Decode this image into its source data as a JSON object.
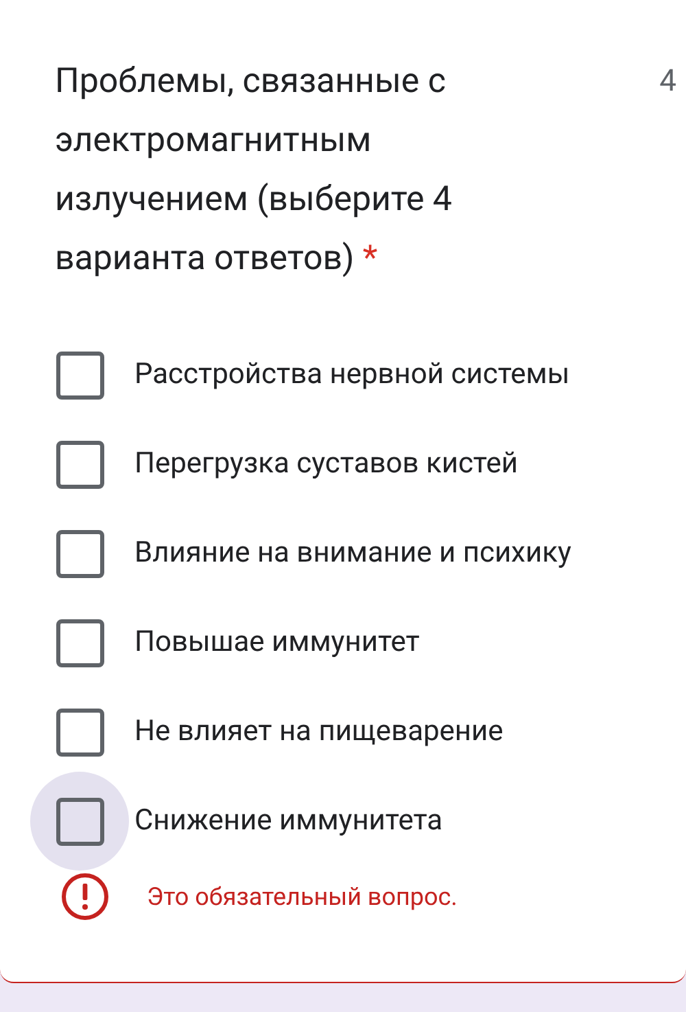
{
  "question": {
    "title": "Проблемы, связанные с электромагнитным излучением (выберите 4 варианта ответов)",
    "required_mark": "*",
    "points": "4"
  },
  "options": [
    {
      "label": "Расстройства нервной системы",
      "checked": false,
      "focused": false
    },
    {
      "label": "Перегрузка суставов кистей",
      "checked": false,
      "focused": false
    },
    {
      "label": "Влияние на внимание и психику",
      "checked": false,
      "focused": false
    },
    {
      "label": "Повышае иммунитет",
      "checked": false,
      "focused": false
    },
    {
      "label": "Не влияет на пищеварение",
      "checked": false,
      "focused": false
    },
    {
      "label": "Снижение иммунитета",
      "checked": false,
      "focused": true
    }
  ],
  "error": {
    "text": "Это обязательный вопрос."
  }
}
